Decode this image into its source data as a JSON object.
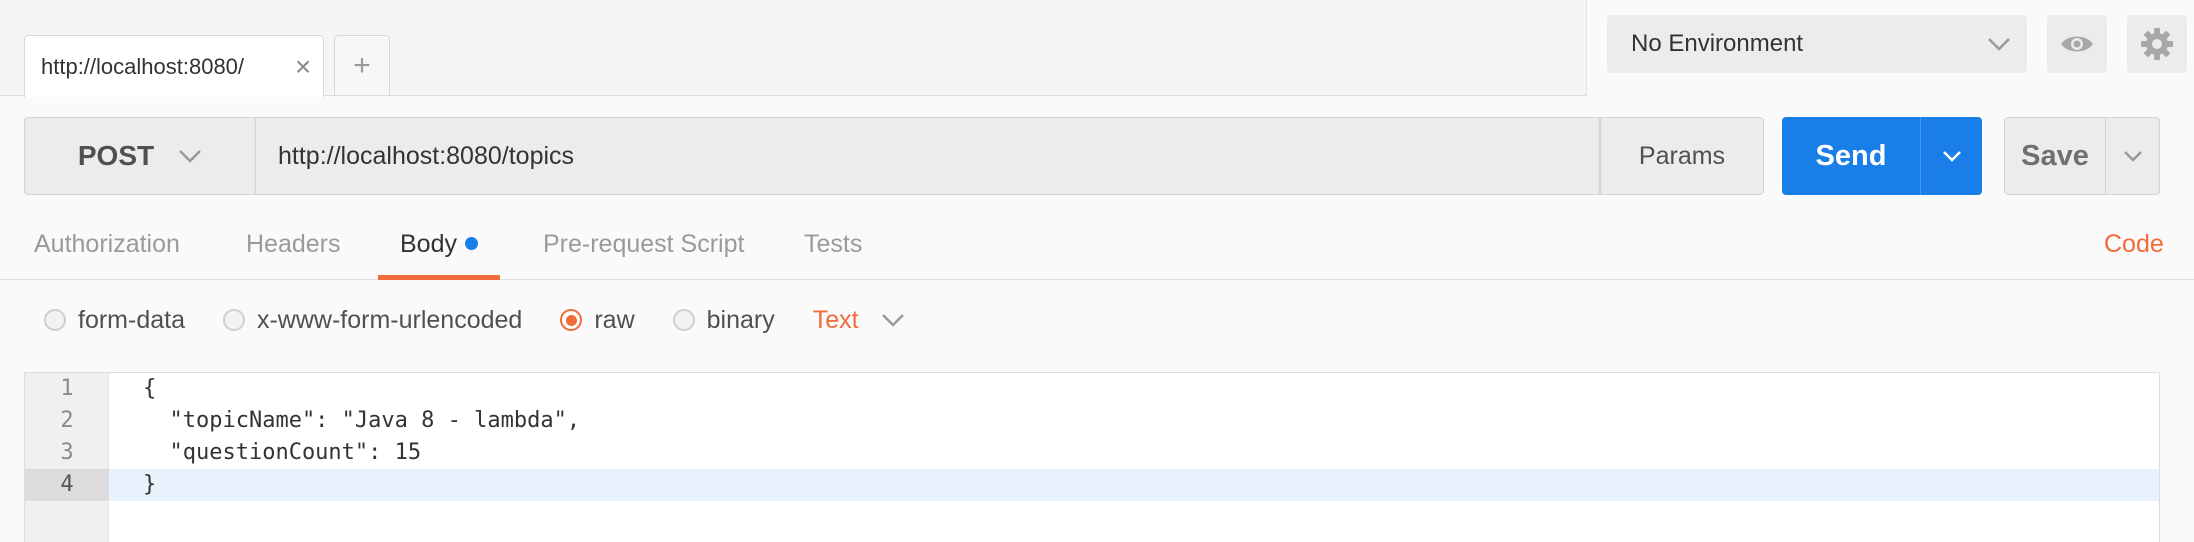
{
  "tabs": {
    "active_tab_label": "http://localhost:8080/",
    "close_glyph": "×",
    "new_tab_glyph": "+"
  },
  "environment": {
    "selected": "No Environment",
    "icons": [
      "chevron-down-icon",
      "eye-icon",
      "gear-icon"
    ]
  },
  "request": {
    "method": "POST",
    "url": "http://localhost:8080/topics",
    "params_label": "Params",
    "send_label": "Send",
    "save_label": "Save"
  },
  "subtabs": [
    {
      "label": "Authorization",
      "active": false
    },
    {
      "label": "Headers",
      "active": false
    },
    {
      "label": "Body",
      "active": true
    },
    {
      "label": "Pre-request Script",
      "active": false
    },
    {
      "label": "Tests",
      "active": false
    }
  ],
  "code_link": "Code",
  "body_types": [
    {
      "label": "form-data",
      "checked": false
    },
    {
      "label": "x-www-form-urlencoded",
      "checked": false
    },
    {
      "label": "raw",
      "checked": true
    },
    {
      "label": "binary",
      "checked": false
    }
  ],
  "raw_format": "Text",
  "editor": {
    "lines": [
      {
        "num": "1",
        "text": "{"
      },
      {
        "num": "2",
        "text": "  \"topicName\": \"Java 8 - lambda\","
      },
      {
        "num": "3",
        "text": "  \"questionCount\": 15"
      },
      {
        "num": "4",
        "text": "}"
      }
    ],
    "current_line": 4
  },
  "colors": {
    "accent_orange": "#f26b3a",
    "send_blue": "#1a7ee8",
    "body_dot_blue": "#1a7ee8"
  }
}
